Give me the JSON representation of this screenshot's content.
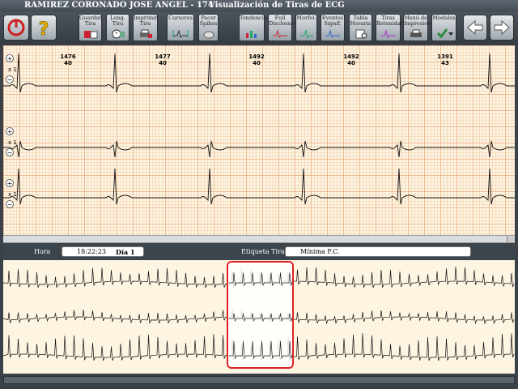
{
  "window": {
    "patient": "RAMIREZ CORONADO JOSE ANGEL - 174",
    "title": "Visualización de Tiras de ECG"
  },
  "toolbar": {
    "power_icon": "power-icon",
    "help_icon": "question-icon",
    "buttons": [
      {
        "label": "Guardar\nTira",
        "icon": "save-strip-icon"
      },
      {
        "label": "Long.\nTira",
        "icon": "strip-length-icon"
      },
      {
        "label": "Imprimir\nTira",
        "icon": "print-strip-icon"
      },
      {
        "label": "Cursores",
        "icon": "cursors-icon"
      },
      {
        "label": "Pacer\nSpikes",
        "icon": "pacer-spikes-icon"
      },
      {
        "label": "Tendencias",
        "icon": "trends-icon"
      },
      {
        "label": "Full\nDisclosure",
        "icon": "full-disclosure-icon"
      },
      {
        "label": "Morfol.",
        "icon": "morphology-icon"
      },
      {
        "label": "Eventos\nSignif.",
        "icon": "events-icon"
      },
      {
        "label": "Tabla\nHoraria",
        "icon": "hourly-table-icon"
      },
      {
        "label": "Tiras\nRetenidas",
        "icon": "retained-strips-icon"
      },
      {
        "label": "Menú de\nImpresión",
        "icon": "print-menu-icon"
      },
      {
        "label": "Módulos",
        "icon": "modules-icon"
      }
    ],
    "nav": {
      "back_icon": "arrow-left-icon",
      "forward_icon": "arrow-right-icon"
    },
    "accent": "#cc2222"
  },
  "strip": {
    "gain_labels": [
      "x 1",
      "x 1",
      "x 1"
    ],
    "beats": [
      {
        "rr": "1476",
        "hr": "40"
      },
      {
        "rr": "1477",
        "hr": "40"
      },
      {
        "rr": "1492",
        "hr": "40"
      },
      {
        "rr": "1492",
        "hr": "40"
      },
      {
        "rr": "1391",
        "hr": "43"
      }
    ],
    "grid_color": "#f0b080",
    "trace_color": "#111111"
  },
  "info": {
    "hora_label": "Hora",
    "time": "18:22:23",
    "day": "Día 1",
    "etiqueta_label": "Etiqueta Tira",
    "etiqueta_value": "Mínima F.C."
  },
  "overview": {
    "selection_color": "#dd2222"
  }
}
